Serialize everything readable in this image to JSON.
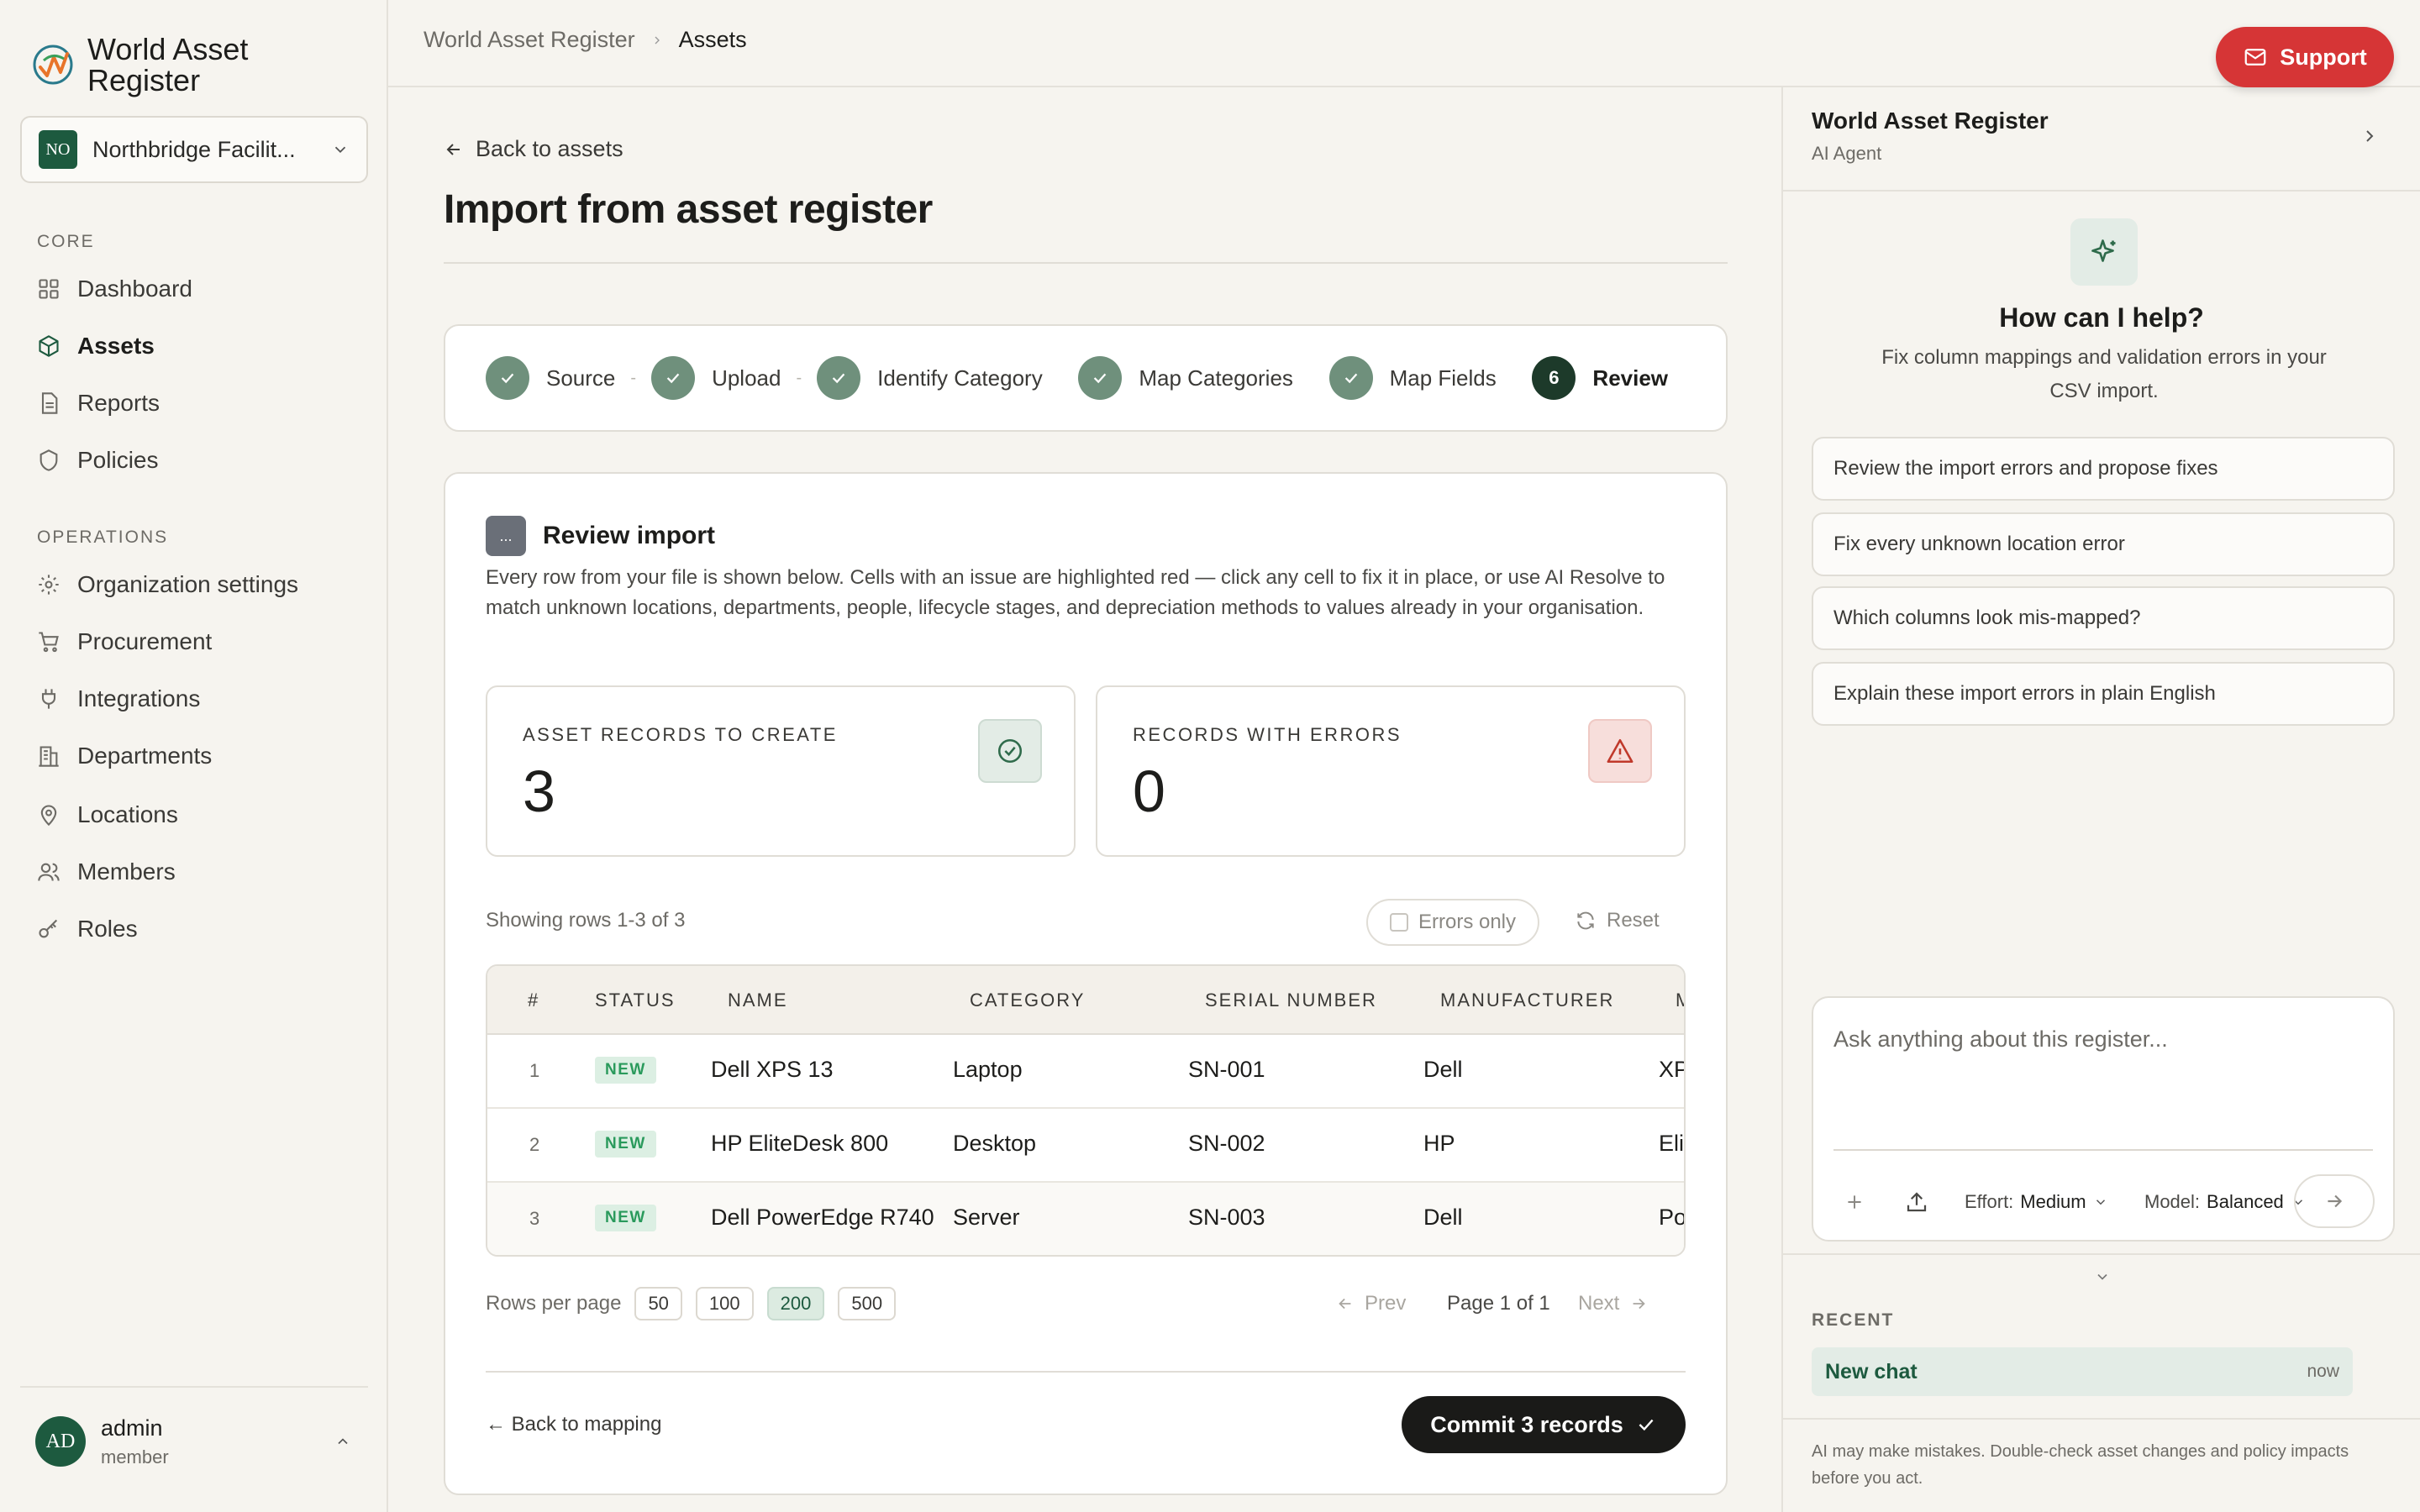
{
  "app": {
    "title": "World Asset Register"
  },
  "org": {
    "badge": "NO",
    "name": "Northbridge Facilit..."
  },
  "nav": {
    "core_label": "CORE",
    "ops_label": "OPERATIONS",
    "core": [
      {
        "label": "Dashboard",
        "icon": "grid-icon"
      },
      {
        "label": "Assets",
        "icon": "cube-icon",
        "active": true
      },
      {
        "label": "Reports",
        "icon": "document-icon"
      },
      {
        "label": "Policies",
        "icon": "shield-icon"
      }
    ],
    "ops": [
      {
        "label": "Organization settings",
        "icon": "gear-icon"
      },
      {
        "label": "Procurement",
        "icon": "cart-icon"
      },
      {
        "label": "Integrations",
        "icon": "plug-icon"
      },
      {
        "label": "Departments",
        "icon": "building-icon"
      },
      {
        "label": "Locations",
        "icon": "pin-icon"
      },
      {
        "label": "Members",
        "icon": "users-icon"
      },
      {
        "label": "Roles",
        "icon": "key-icon"
      }
    ]
  },
  "user": {
    "initials": "AD",
    "name": "admin",
    "role": "member"
  },
  "breadcrumb": {
    "root": "World Asset Register",
    "current": "Assets"
  },
  "support": {
    "label": "Support"
  },
  "page": {
    "back": "Back to assets",
    "title": "Import from asset register"
  },
  "steps": [
    {
      "label": "Source",
      "state": "done"
    },
    {
      "label": "Upload",
      "state": "done"
    },
    {
      "label": "Identify Category",
      "state": "done"
    },
    {
      "label": "Map Categories",
      "state": "done"
    },
    {
      "label": "Map Fields",
      "state": "done"
    },
    {
      "label": "Review",
      "number": "6",
      "state": "active"
    }
  ],
  "review": {
    "icon_text": "...",
    "title": "Review import",
    "description": "Every row from your file is shown below. Cells with an issue are highlighted red — click any cell to fix it in place, or use AI Resolve to match unknown locations, departments, people, lifecycle stages, and depreciation methods to values already in your organisation.",
    "stats": [
      {
        "label": "ASSET RECORDS TO CREATE",
        "value": "3",
        "icon": "check-circle-icon",
        "color": "#2f6b4b"
      },
      {
        "label": "RECORDS WITH ERRORS",
        "value": "0",
        "icon": "warning-icon",
        "color": "#c0392b"
      }
    ],
    "rows_info": "Showing rows 1-3 of 3",
    "errors_only": "Errors only",
    "reset": "Reset"
  },
  "table": {
    "headers": [
      "#",
      "STATUS",
      "NAME",
      "CATEGORY",
      "SERIAL NUMBER",
      "MANUFACTURER",
      "M"
    ],
    "rows": [
      {
        "num": "1",
        "status": "NEW",
        "name": "Dell XPS 13",
        "category": "Laptop",
        "serial": "SN-001",
        "manufacturer": "Dell",
        "model": "XP"
      },
      {
        "num": "2",
        "status": "NEW",
        "name": "HP EliteDesk 800",
        "category": "Desktop",
        "serial": "SN-002",
        "manufacturer": "HP",
        "model": "Eli"
      },
      {
        "num": "3",
        "status": "NEW",
        "name": "Dell PowerEdge R740",
        "category": "Server",
        "serial": "SN-003",
        "manufacturer": "Dell",
        "model": "Po"
      }
    ]
  },
  "pager": {
    "rows_per_page_label": "Rows per page",
    "options": [
      "50",
      "100",
      "200",
      "500"
    ],
    "selected": "200",
    "prev": "Prev",
    "page_info": "Page 1 of 1",
    "next": "Next"
  },
  "footer": {
    "back_mapping": "← Back to mapping",
    "commit": "Commit 3 records"
  },
  "agent": {
    "title": "World Asset Register",
    "subtitle": "AI Agent",
    "help_title": "How can I help?",
    "help_desc": "Fix column mappings and validation errors in your CSV import.",
    "suggestions": [
      "Review the import errors and propose fixes",
      "Fix every unknown location error",
      "Which columns look mis-mapped?",
      "Explain these import errors in plain English"
    ],
    "placeholder": "Ask anything about this register...",
    "effort_label": "Effort:",
    "effort_value": "Medium",
    "model_label": "Model:",
    "model_value": "Balanced",
    "recent_label": "RECENT",
    "recent": [
      {
        "name": "New chat",
        "time": "now"
      }
    ],
    "disclaimer": "AI may make mistakes. Double-check asset changes and policy impacts before you act."
  }
}
